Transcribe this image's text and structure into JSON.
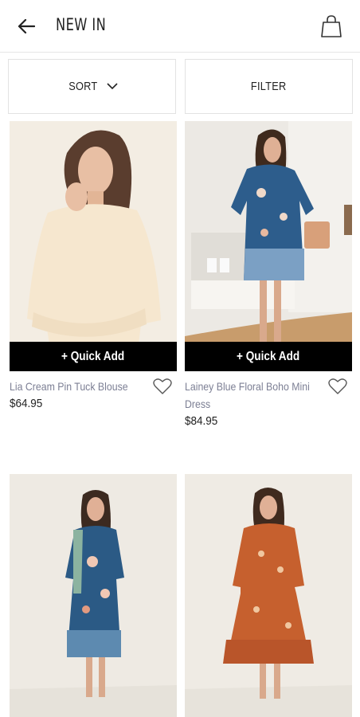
{
  "header": {
    "title": "NEW IN",
    "back_icon": "arrow-left-icon",
    "bag_icon": "shopping-bag-icon"
  },
  "controls": {
    "sort_label": "SORT",
    "filter_label": "FILTER"
  },
  "products": [
    {
      "name": "Lia Cream Pin Tuck Blouse",
      "price": "$64.95",
      "quick_add": "+ Quick Add"
    },
    {
      "name_line1": "Lainey Blue Floral Boho Mini",
      "name_line2": "Dress",
      "price": "$84.95",
      "quick_add": "+ Quick Add"
    },
    {
      "image": "blue floral midi dress"
    },
    {
      "image": "rust floral maxi dress"
    }
  ],
  "colors": {
    "quick_add_bg": "#000000",
    "product_name": "#7c7f94"
  }
}
